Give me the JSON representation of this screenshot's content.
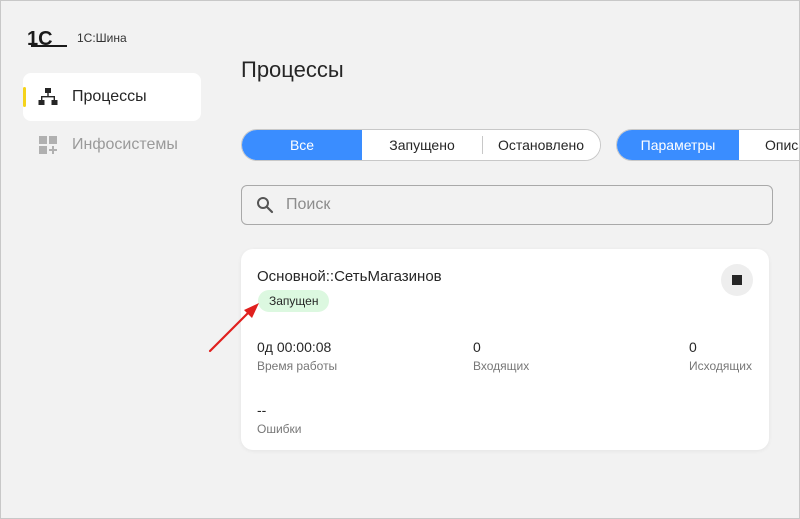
{
  "app": {
    "logo_mark": "1С",
    "title": "1С:Шина"
  },
  "sidebar": {
    "items": [
      {
        "label": "Процессы",
        "icon": "process-tree-icon",
        "active": true
      },
      {
        "label": "Инфосистемы",
        "icon": "apps-add-icon",
        "active": false
      }
    ]
  },
  "main": {
    "title": "Процессы",
    "filter_tabs": [
      "Все",
      "Запущено",
      "Остановлено"
    ],
    "active_filter": "Все",
    "view_tabs": [
      "Параметры",
      "Описа"
    ],
    "active_view": "Параметры",
    "search": {
      "placeholder": "Поиск",
      "value": ""
    }
  },
  "process_card": {
    "name": "Основной::СетьМагазинов",
    "status": "Запущен",
    "metrics": [
      {
        "value": "0д 00:00:08",
        "label": "Время работы"
      },
      {
        "value": "0",
        "label": "Входящих"
      },
      {
        "value": "0",
        "label": "Исходящих"
      },
      {
        "value": "--",
        "label": "Ошибки"
      }
    ]
  },
  "colors": {
    "accent": "#3a8dff",
    "active_indicator": "#f5d31b",
    "status_running_bg": "#dcf8e0",
    "annotation_arrow": "#e0201e"
  }
}
